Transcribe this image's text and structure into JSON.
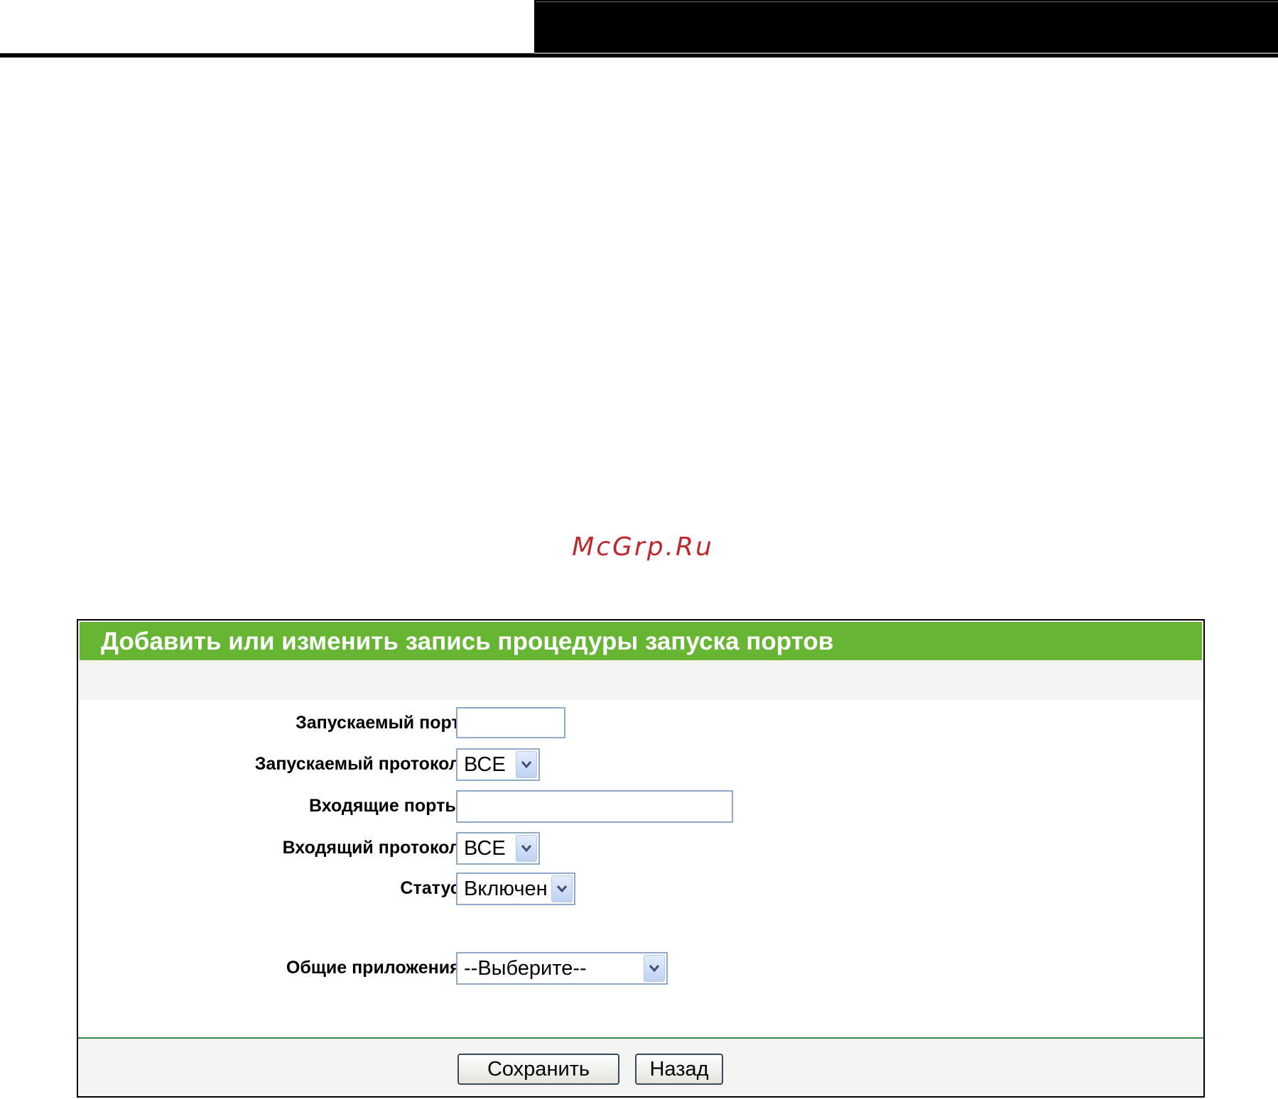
{
  "watermark": "McGrp.Ru",
  "dialog": {
    "title": "Добавить или изменить запись процедуры запуска портов",
    "fields": {
      "trigger_port_label": "Запускаемый порт:",
      "trigger_port_value": "",
      "trigger_protocol_label": "Запускаемый протокол:",
      "trigger_protocol_value": "ВСЕ",
      "incoming_ports_label": "Входящие порты:",
      "incoming_ports_value": "",
      "incoming_protocol_label": "Входящий протокол:",
      "incoming_protocol_value": "ВСЕ",
      "status_label": "Статус:",
      "status_value": "Включен",
      "common_apps_label": "Общие приложения:",
      "common_apps_value": "--Выберите--"
    },
    "buttons": {
      "save_label": "Сохранить",
      "back_label": "Назад"
    }
  },
  "colors": {
    "header_green": "#66b533",
    "divider_green": "#3b8a4a",
    "watermark_red": "#c0272d"
  }
}
